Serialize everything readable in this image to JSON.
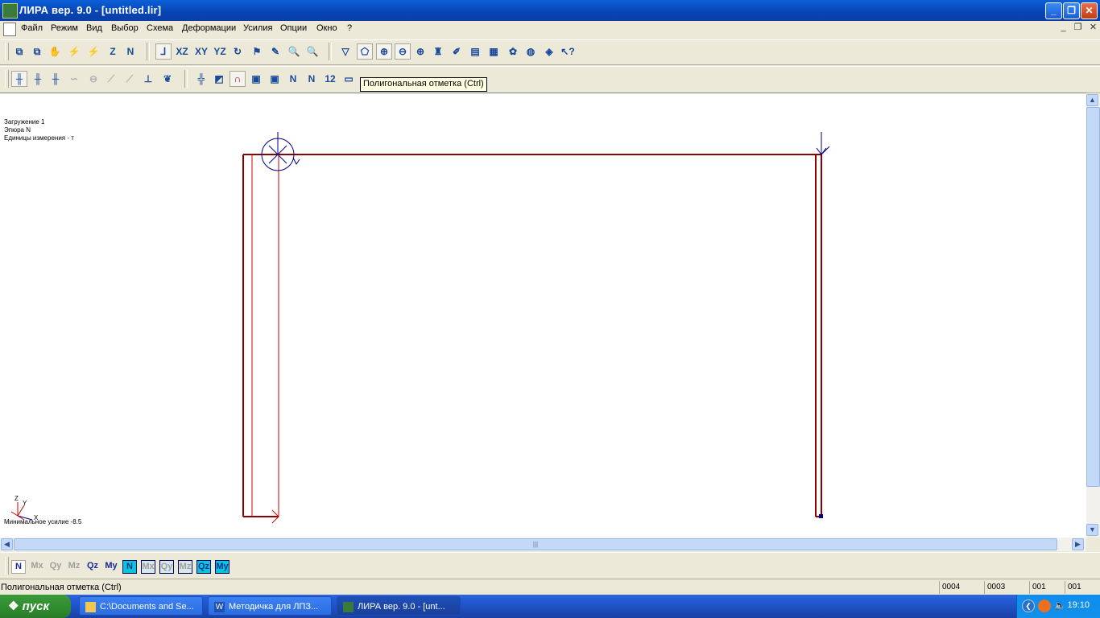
{
  "window": {
    "title": "ЛИРА  вер. 9.0 - [untitled.lir]"
  },
  "menu": [
    "Файл",
    "Режим",
    "Вид",
    "Выбор",
    "Схема",
    "Деформации",
    "Усилия",
    "Опции",
    "Окно",
    "?"
  ],
  "tooltip": "Полигональная отметка (Ctrl)",
  "canvas": {
    "info_lines": [
      "Загружение  1",
      "Эпюра  N",
      "Единицы измерения - т"
    ],
    "min_force_label": "Минимальное усилие  -8.5",
    "axis_labels": {
      "z": "Z",
      "y": "Y",
      "x": "X"
    }
  },
  "bottom_toolbar": [
    {
      "label": "N",
      "state": "pressed"
    },
    {
      "label": "Mx",
      "state": "disabled"
    },
    {
      "label": "Qy",
      "state": "disabled"
    },
    {
      "label": "Mz",
      "state": "disabled"
    },
    {
      "label": "Qz",
      "state": "normal"
    },
    {
      "label": "My",
      "state": "normal"
    },
    {
      "label": "N",
      "state": "boxed"
    },
    {
      "label": "Mx",
      "state": "boxed-disabled"
    },
    {
      "label": "Qy",
      "state": "boxed-disabled"
    },
    {
      "label": "Mz",
      "state": "boxed-disabled"
    },
    {
      "label": "Qz",
      "state": "boxed"
    },
    {
      "label": "My",
      "state": "boxed"
    }
  ],
  "statusbar": {
    "message": "Полигональная отметка (Ctrl)",
    "cells": [
      "0004",
      "0003",
      "001",
      "001"
    ]
  },
  "taskbar": {
    "start_label": "пуск",
    "tasks": [
      {
        "label": "C:\\Documents and Se...",
        "icon": "folder-icon"
      },
      {
        "label": "Методичка для ЛПЗ...",
        "icon": "word-icon"
      },
      {
        "label": "ЛИРА  вер. 9.0 - [unt...",
        "icon": "lira-icon"
      }
    ],
    "clock": "19:10"
  },
  "colors": {
    "frame_red": "#8b0000",
    "diagram_red": "#cc0000",
    "axis_blue": "#000080"
  }
}
